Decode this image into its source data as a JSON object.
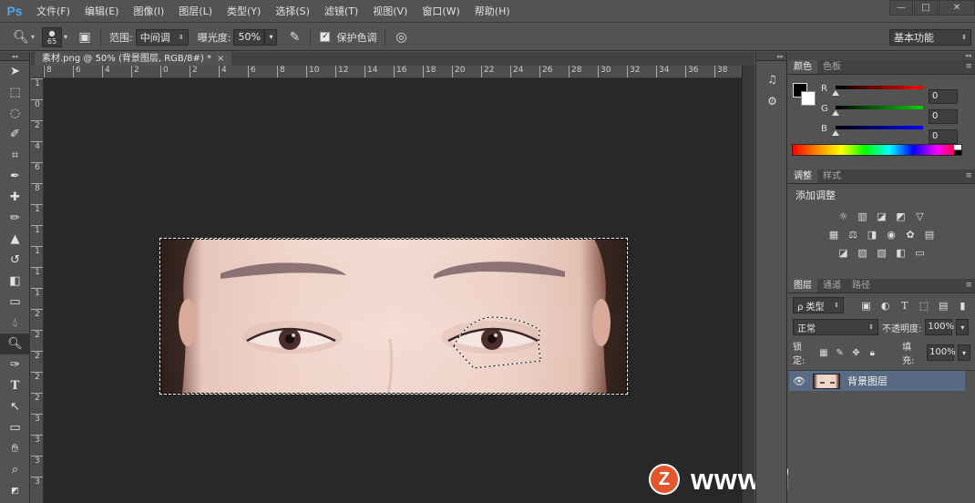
{
  "app": {
    "logo": "Ps"
  },
  "menu": [
    "文件(F)",
    "编辑(E)",
    "图像(I)",
    "图层(L)",
    "类型(Y)",
    "选择(S)",
    "滤镜(T)",
    "视图(V)",
    "窗口(W)",
    "帮助(H)"
  ],
  "window_controls": {
    "minimize": "—",
    "maximize": "□",
    "close": "✕"
  },
  "options": {
    "brush_size": "65",
    "range_label": "范围:",
    "range_value": "中间调",
    "exposure_label": "曝光度:",
    "exposure_value": "50%",
    "protect_tone_label": "保护色调",
    "protect_tone_checked": "✓",
    "workspace": "基本功能"
  },
  "document": {
    "tab_title": "素材.png @ 50% (背景图层, RGB/8#) *",
    "tab_close": "×",
    "ruler_h": [
      "8",
      "6",
      "4",
      "2",
      "0",
      "2",
      "4",
      "6",
      "8",
      "10",
      "12",
      "14",
      "16",
      "18",
      "20",
      "22",
      "24",
      "26",
      "28",
      "30",
      "32",
      "34",
      "36",
      "38"
    ],
    "ruler_v": [
      "1",
      "0",
      "2",
      "4",
      "6",
      "8",
      "1",
      "1",
      "1",
      "1",
      "1",
      "2",
      "2",
      "2",
      "2",
      "2",
      "3",
      "3",
      "3",
      "3"
    ]
  },
  "watermark": {
    "logo_letter": "Z",
    "text": "www.MacZ.com"
  },
  "color_panel": {
    "tabs": [
      "颜色",
      "色板"
    ],
    "r_label": "R",
    "g_label": "G",
    "b_label": "B",
    "r_value": "0",
    "g_value": "0",
    "b_value": "0"
  },
  "adjust_panel": {
    "tabs": [
      "调整",
      "样式"
    ],
    "title": "添加调整"
  },
  "layers_panel": {
    "tabs": [
      "图层",
      "通道",
      "路径"
    ],
    "filter_kind": "ρ 类型",
    "blend_mode": "正常",
    "opacity_label": "不透明度:",
    "opacity_value": "100%",
    "lock_label": "锁定:",
    "fill_label": "填充:",
    "fill_value": "100%",
    "layer_name": "背景图层"
  },
  "colors": {
    "accent": "#4fa3e8",
    "selected_layer": "#596a83"
  }
}
